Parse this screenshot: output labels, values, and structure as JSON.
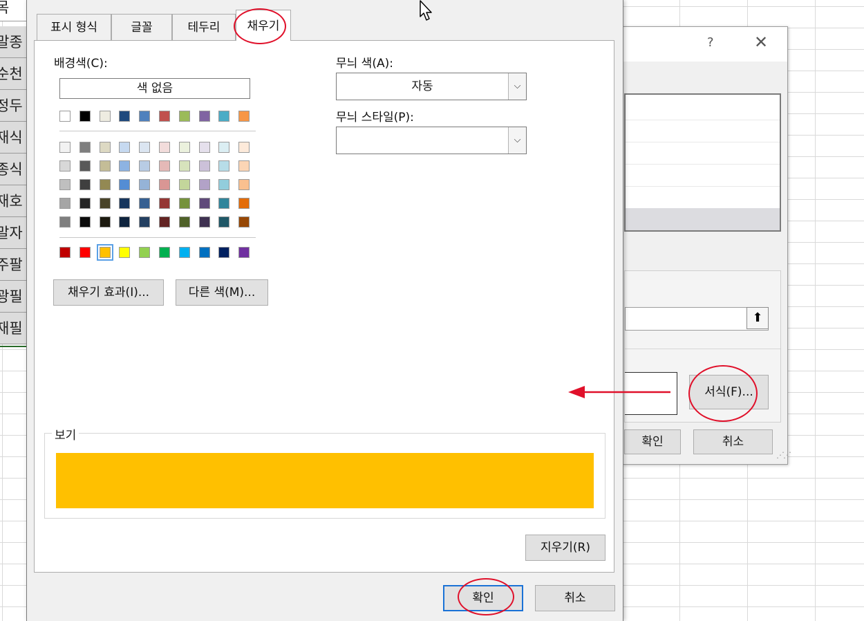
{
  "sheet": {
    "row_labels": [
      "목",
      "말종",
      "순천",
      "정두",
      "재식",
      "종식",
      "재호",
      "말자",
      "주팔",
      "광필",
      "재필"
    ]
  },
  "background_dialog": {
    "help_glyph": "?",
    "close_glyph": "✕",
    "upload_glyph": "⬆",
    "format_button": "서식(F)...",
    "ok_button": "확인",
    "cancel_button": "취소"
  },
  "dialog": {
    "tabs": [
      {
        "label": "표시 형식",
        "active": false
      },
      {
        "label": "글꼴",
        "active": false
      },
      {
        "label": "테두리",
        "active": false
      },
      {
        "label": "채우기",
        "active": true
      }
    ],
    "background_color_label": "배경색(C):",
    "no_color_button": "색 없음",
    "palette": {
      "top_row": [
        "#ffffff",
        "#000000",
        "#eeece1",
        "#1f497d",
        "#4f81bd",
        "#c0504d",
        "#9bbb59",
        "#8064a2",
        "#4bacc6",
        "#f79646"
      ],
      "shades": [
        [
          "#f2f2f2",
          "#7f7f7f",
          "#ddd9c3",
          "#c6d9f0",
          "#dbe5f1",
          "#f2dcdb",
          "#ebf1dd",
          "#e5e0ec",
          "#dbeef3",
          "#fdeada"
        ],
        [
          "#d8d8d8",
          "#595959",
          "#c4bd97",
          "#8db3e2",
          "#b8cce4",
          "#e5b9b7",
          "#d7e3bc",
          "#ccc1d9",
          "#b7dde8",
          "#fbd5b5"
        ],
        [
          "#bfbfbf",
          "#3f3f3f",
          "#938953",
          "#548dd4",
          "#95b3d7",
          "#d99694",
          "#c3d69b",
          "#b2a2c7",
          "#92cddc",
          "#fac08f"
        ],
        [
          "#a5a5a5",
          "#262626",
          "#494429",
          "#17365d",
          "#366092",
          "#953734",
          "#76923c",
          "#5f497a",
          "#31859b",
          "#e36c09"
        ],
        [
          "#7f7f7f",
          "#0c0c0c",
          "#1d1b10",
          "#0f243e",
          "#244061",
          "#632423",
          "#4f6128",
          "#3f3151",
          "#205867",
          "#974806"
        ]
      ],
      "standard": [
        "#c00000",
        "#ff0000",
        "#ffc000",
        "#ffff00",
        "#92d050",
        "#00b050",
        "#00b0f0",
        "#0070c0",
        "#002060",
        "#7030a0"
      ],
      "selected_standard_index": 2
    },
    "fill_effects_button": "채우기 효과(I)...",
    "more_colors_button": "다른 색(M)...",
    "pattern_color_label": "무늬 색(A):",
    "pattern_color_value": "자동",
    "pattern_style_label": "무늬 스타일(P):",
    "pattern_style_value": "",
    "dropdown_glyph": "⌵",
    "preview_label": "보기",
    "preview_color": "#ffc000",
    "clear_button": "지우기(R)",
    "ok_button": "확인",
    "cancel_button": "취소"
  },
  "annotation_color": "#e0102a"
}
